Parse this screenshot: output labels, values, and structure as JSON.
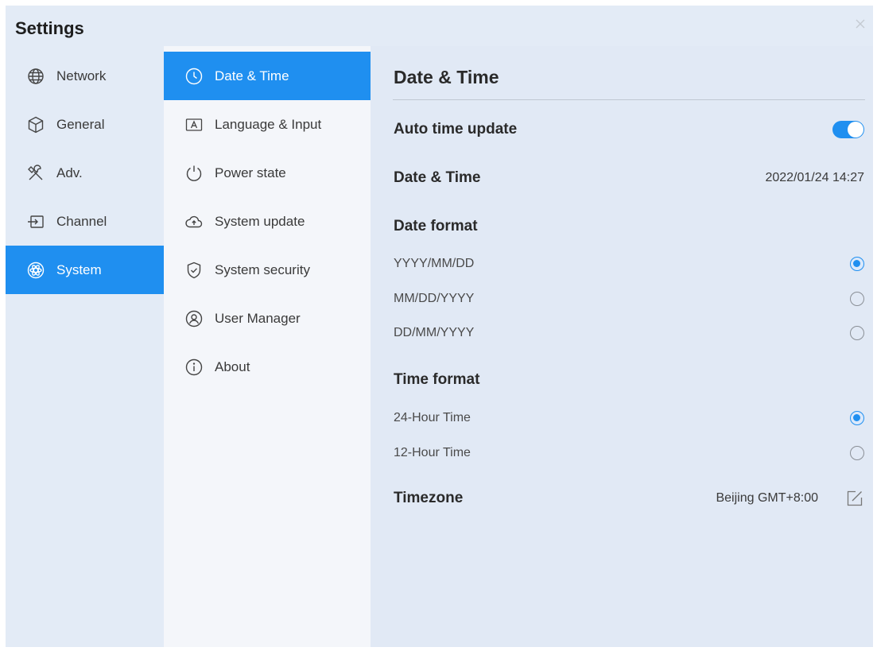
{
  "window": {
    "title": "Settings",
    "close_icon": "close-icon"
  },
  "categories": [
    {
      "label": "Network",
      "icon": "globe-icon",
      "active": false
    },
    {
      "label": "General",
      "icon": "cube-icon",
      "active": false
    },
    {
      "label": "Adv.",
      "icon": "tools-icon",
      "active": false
    },
    {
      "label": "Channel",
      "icon": "input-source-icon",
      "active": false
    },
    {
      "label": "System",
      "icon": "atom-icon",
      "active": true
    }
  ],
  "subnav": [
    {
      "label": "Date & Time",
      "icon": "clock-icon",
      "active": true
    },
    {
      "label": "Language & Input",
      "icon": "keyboard-letter-icon",
      "active": false
    },
    {
      "label": "Power state",
      "icon": "power-icon",
      "active": false
    },
    {
      "label": "System update",
      "icon": "cloud-upload-icon",
      "active": false
    },
    {
      "label": "System security",
      "icon": "shield-check-icon",
      "active": false
    },
    {
      "label": "User Manager",
      "icon": "user-icon",
      "active": false
    },
    {
      "label": "About",
      "icon": "info-icon",
      "active": false
    }
  ],
  "panel": {
    "title": "Date & Time",
    "auto_time_update": {
      "label": "Auto time update",
      "enabled": true
    },
    "date_time": {
      "label": "Date & Time",
      "value": "2022/01/24 14:27"
    },
    "date_format": {
      "label": "Date format",
      "options": [
        {
          "label": "YYYY/MM/DD",
          "selected": true
        },
        {
          "label": "MM/DD/YYYY",
          "selected": false
        },
        {
          "label": "DD/MM/YYYY",
          "selected": false
        }
      ]
    },
    "time_format": {
      "label": "Time format",
      "options": [
        {
          "label": "24-Hour Time",
          "selected": true
        },
        {
          "label": "12-Hour Time",
          "selected": false
        }
      ]
    },
    "timezone": {
      "label": "Timezone",
      "value": "Beijing GMT+8:00",
      "edit_icon": "edit-icon"
    }
  },
  "colors": {
    "accent": "#1f8ff0",
    "window_bg": "#e3ebf6",
    "subnav_bg": "#f4f6fa"
  }
}
